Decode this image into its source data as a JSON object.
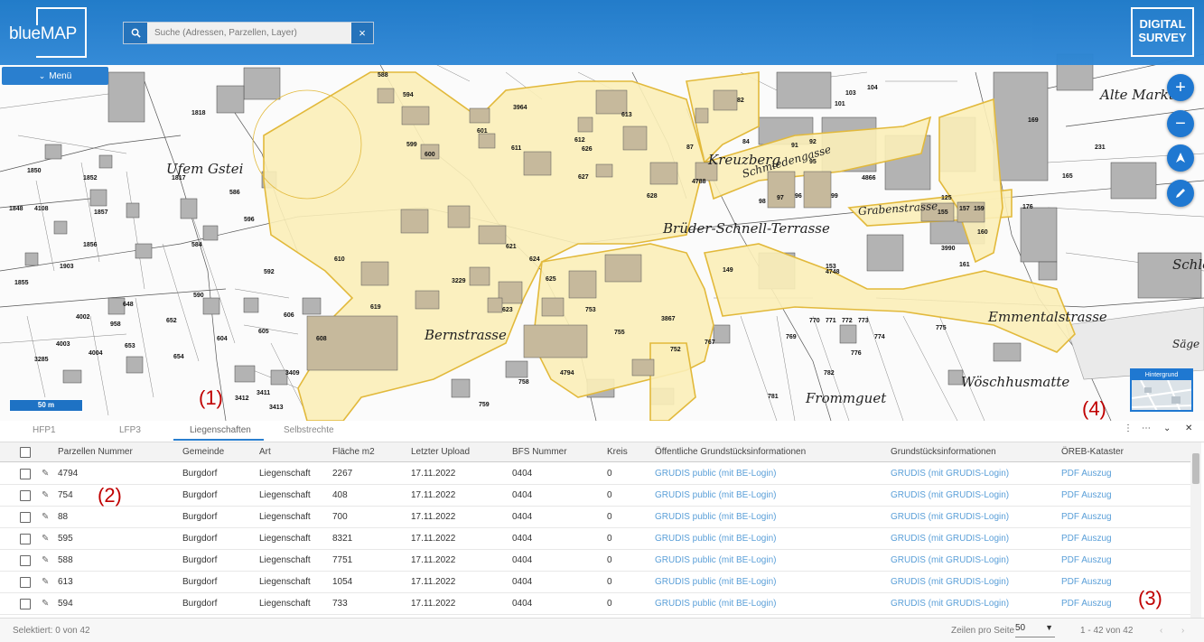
{
  "header": {
    "app_logo": "blueMAP",
    "search_placeholder": "Suche (Adressen, Parzellen, Layer)",
    "brand_line1": "DIGITAL",
    "brand_line2": "SURVEY",
    "menu_label": "Menü"
  },
  "map": {
    "labels": {
      "ufem_gstei": "Ufem Gstei",
      "bernstrasse": "Bernstrasse",
      "brueder": "Brüder-Schnell-Terrasse",
      "kreuzberg": "Kreuzberg",
      "alte_markt": "Alte Markt",
      "emmentalstrasse": "Emmentalstrasse",
      "woeschhusmatte": "Wöschhusmatte",
      "frommguet": "Frommguet",
      "schloss": "Schlo",
      "saege": "Säge",
      "schmiedengasse": "Schmiedengasse",
      "grabenstrasse": "Grabenstrasse"
    },
    "scale": "50 m",
    "background_switch": "Hintergrund",
    "annotations": [
      "(1)",
      "(2)",
      "(3)",
      "(4)"
    ],
    "parcel_numbers": [
      "588",
      "594",
      "599",
      "600",
      "601",
      "611",
      "612",
      "613",
      "626",
      "627",
      "628",
      "610",
      "619",
      "621",
      "623",
      "624",
      "625",
      "752",
      "753",
      "755",
      "758",
      "759",
      "767",
      "769",
      "775",
      "776",
      "781",
      "782",
      "3229",
      "3964",
      "4794",
      "3867",
      "1818",
      "1817",
      "1850",
      "1852",
      "1848",
      "4108",
      "1857",
      "1856",
      "1903",
      "1855",
      "584",
      "586",
      "590",
      "592",
      "596",
      "604",
      "605",
      "606",
      "608",
      "648",
      "652",
      "653",
      "654",
      "958",
      "4002",
      "4003",
      "4004",
      "3409",
      "3411",
      "3412",
      "3285",
      "3413",
      "82",
      "84",
      "87",
      "91",
      "92",
      "95",
      "96",
      "97",
      "98",
      "99",
      "101",
      "103",
      "104",
      "125",
      "149",
      "153",
      "155",
      "157",
      "159",
      "160",
      "161",
      "165",
      "169",
      "176",
      "231",
      "4788",
      "4866",
      "4748",
      "3990",
      "770",
      "771",
      "772",
      "773",
      "774"
    ]
  },
  "tabs": {
    "items": [
      "HFP1",
      "LFP3",
      "Liegenschaften",
      "Selbstrechte"
    ],
    "active": "Liegenschaften"
  },
  "table": {
    "columns": [
      "Parzellen Nummer",
      "Gemeinde",
      "Art",
      "Fläche m2",
      "Letzter Upload",
      "BFS Nummer",
      "Kreis",
      "Öffentliche Grundstücksinformationen",
      "Grundstücksinformationen",
      "ÖREB-Kataster"
    ],
    "rows": [
      [
        "4794",
        "Burgdorf",
        "Liegenschaft",
        "2267",
        "17.11.2022",
        "0404",
        "0",
        "GRUDIS public (mit BE-Login)",
        "GRUDIS (mit GRUDIS-Login)",
        "PDF Auszug"
      ],
      [
        "754",
        "Burgdorf",
        "Liegenschaft",
        "408",
        "17.11.2022",
        "0404",
        "0",
        "GRUDIS public (mit BE-Login)",
        "GRUDIS (mit GRUDIS-Login)",
        "PDF Auszug"
      ],
      [
        "88",
        "Burgdorf",
        "Liegenschaft",
        "700",
        "17.11.2022",
        "0404",
        "0",
        "GRUDIS public (mit BE-Login)",
        "GRUDIS (mit GRUDIS-Login)",
        "PDF Auszug"
      ],
      [
        "595",
        "Burgdorf",
        "Liegenschaft",
        "8321",
        "17.11.2022",
        "0404",
        "0",
        "GRUDIS public (mit BE-Login)",
        "GRUDIS (mit GRUDIS-Login)",
        "PDF Auszug"
      ],
      [
        "588",
        "Burgdorf",
        "Liegenschaft",
        "7751",
        "17.11.2022",
        "0404",
        "0",
        "GRUDIS public (mit BE-Login)",
        "GRUDIS (mit GRUDIS-Login)",
        "PDF Auszug"
      ],
      [
        "613",
        "Burgdorf",
        "Liegenschaft",
        "1054",
        "17.11.2022",
        "0404",
        "0",
        "GRUDIS public (mit BE-Login)",
        "GRUDIS (mit GRUDIS-Login)",
        "PDF Auszug"
      ],
      [
        "594",
        "Burgdorf",
        "Liegenschaft",
        "733",
        "17.11.2022",
        "0404",
        "0",
        "GRUDIS public (mit BE-Login)",
        "GRUDIS (mit GRUDIS-Login)",
        "PDF Auszug"
      ]
    ]
  },
  "footer": {
    "selected": "Selektiert: 0 von 42",
    "rows_per_page_label": "Zeilen pro Seite",
    "rows_per_page_value": "50",
    "range": "1 - 42 von 42"
  },
  "colors": {
    "brand_blue": "#1f78d1",
    "highlight_fill": "#fbeeb8",
    "highlight_stroke": "#e2b93b",
    "link": "#5a9fd8",
    "annotation": "#c00000"
  }
}
